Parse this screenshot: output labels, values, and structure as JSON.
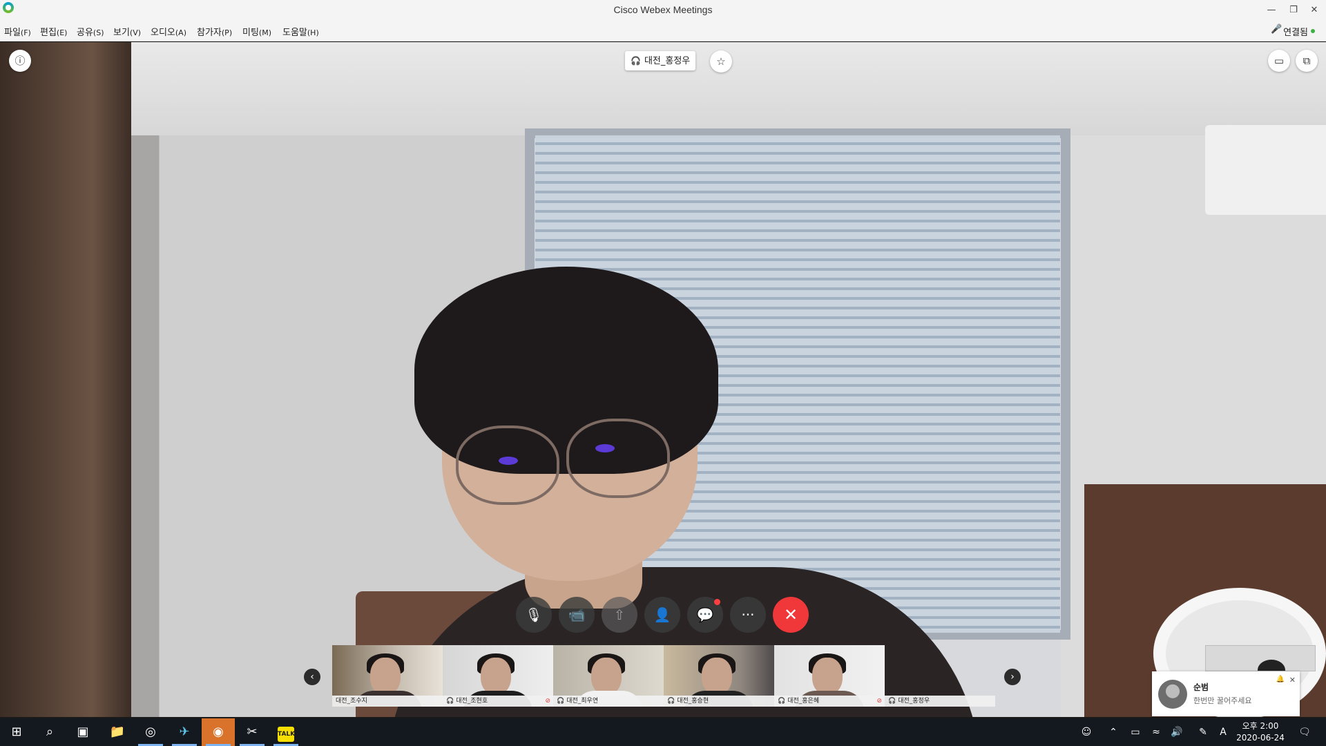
{
  "window": {
    "title": "Cisco Webex Meetings",
    "controls": [
      "—",
      "❐",
      "✕"
    ]
  },
  "menu": [
    {
      "label": "파일",
      "key": "(F)"
    },
    {
      "label": "편집",
      "key": "(E)"
    },
    {
      "label": "공유",
      "key": "(S)"
    },
    {
      "label": "보기",
      "key": "(V)"
    },
    {
      "label": "오디오",
      "key": "(A)"
    },
    {
      "label": "참가자",
      "key": "(P)"
    },
    {
      "label": "미팅",
      "key": "(M)"
    },
    {
      "label": "도움말",
      "key": "(H)"
    }
  ],
  "status": {
    "connection": "연결됨"
  },
  "speaker": {
    "name": "대전_홍정우"
  },
  "controls": {
    "mute_icon": "microphone-muted-icon",
    "video_icon": "video-camera-icon",
    "share_icon": "share-icon",
    "participants_icon": "participants-icon",
    "chat_icon": "chat-bubble-icon",
    "more_label": "···",
    "end_icon": "close-x-icon"
  },
  "participants": [
    {
      "name": "대전_조수지",
      "icon": "",
      "muted": false
    },
    {
      "name": "대전_조현호",
      "icon": "headset",
      "muted": true
    },
    {
      "name": "대전_최우연",
      "icon": "headset",
      "muted": false
    },
    {
      "name": "대전_홍승현",
      "icon": "headset",
      "muted": false
    },
    {
      "name": "대전_홍은혜",
      "icon": "headset",
      "muted": true
    },
    {
      "name": "대전_홍정우",
      "icon": "headset",
      "muted": false
    }
  ],
  "notification": {
    "sender": "순범",
    "message": "한번만 꿀어주세요"
  },
  "taskbar": {
    "clock_time": "오후 2:00",
    "clock_date": "2020-06-24",
    "ime": "A",
    "notif_count": "1"
  },
  "colors": {
    "end_button": "#f0383a",
    "connected": "#3cb043",
    "accent": "#00a0d1"
  }
}
